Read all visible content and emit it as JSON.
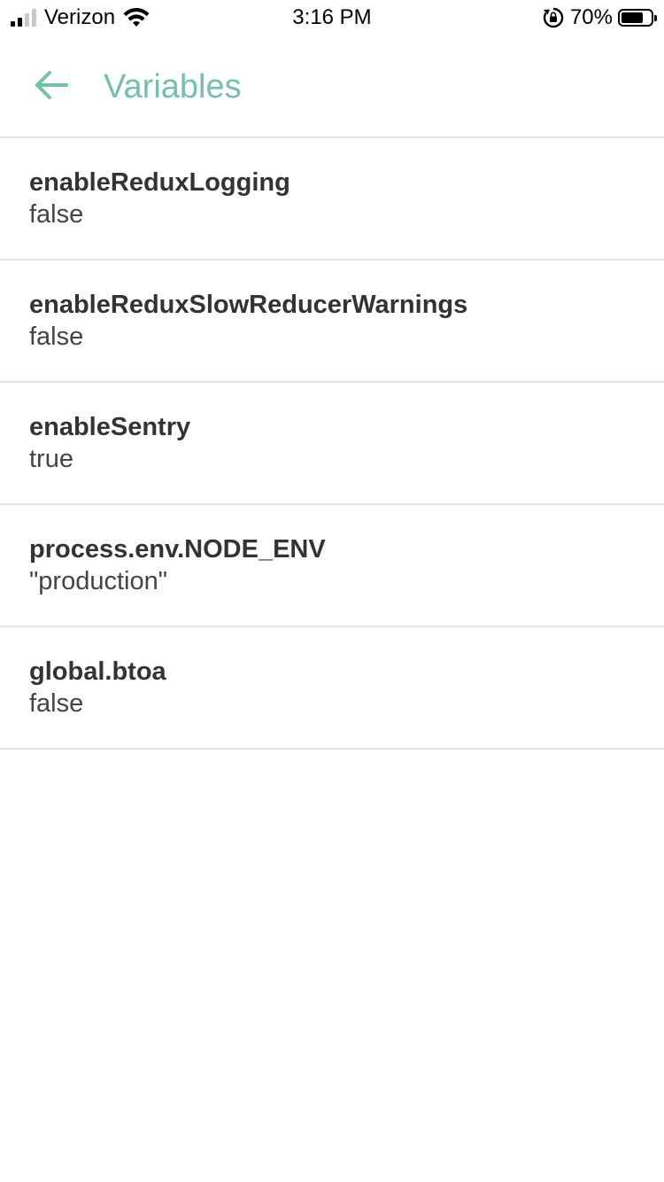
{
  "status_bar": {
    "carrier": "Verizon",
    "time": "3:16 PM",
    "battery_percent": "70%",
    "signal_bars_filled": 2,
    "signal_bars_total": 4,
    "battery_level": 0.7
  },
  "header": {
    "back_icon": "arrow-left-icon",
    "title": "Variables",
    "accent_color": "#74c0ad"
  },
  "variables": [
    {
      "name": "enableReduxLogging",
      "value": "false"
    },
    {
      "name": "enableReduxSlowReducerWarnings",
      "value": "false"
    },
    {
      "name": "enableSentry",
      "value": "true"
    },
    {
      "name": "process.env.NODE_ENV",
      "value": "\"production\""
    },
    {
      "name": "global.btoa",
      "value": "false"
    }
  ]
}
